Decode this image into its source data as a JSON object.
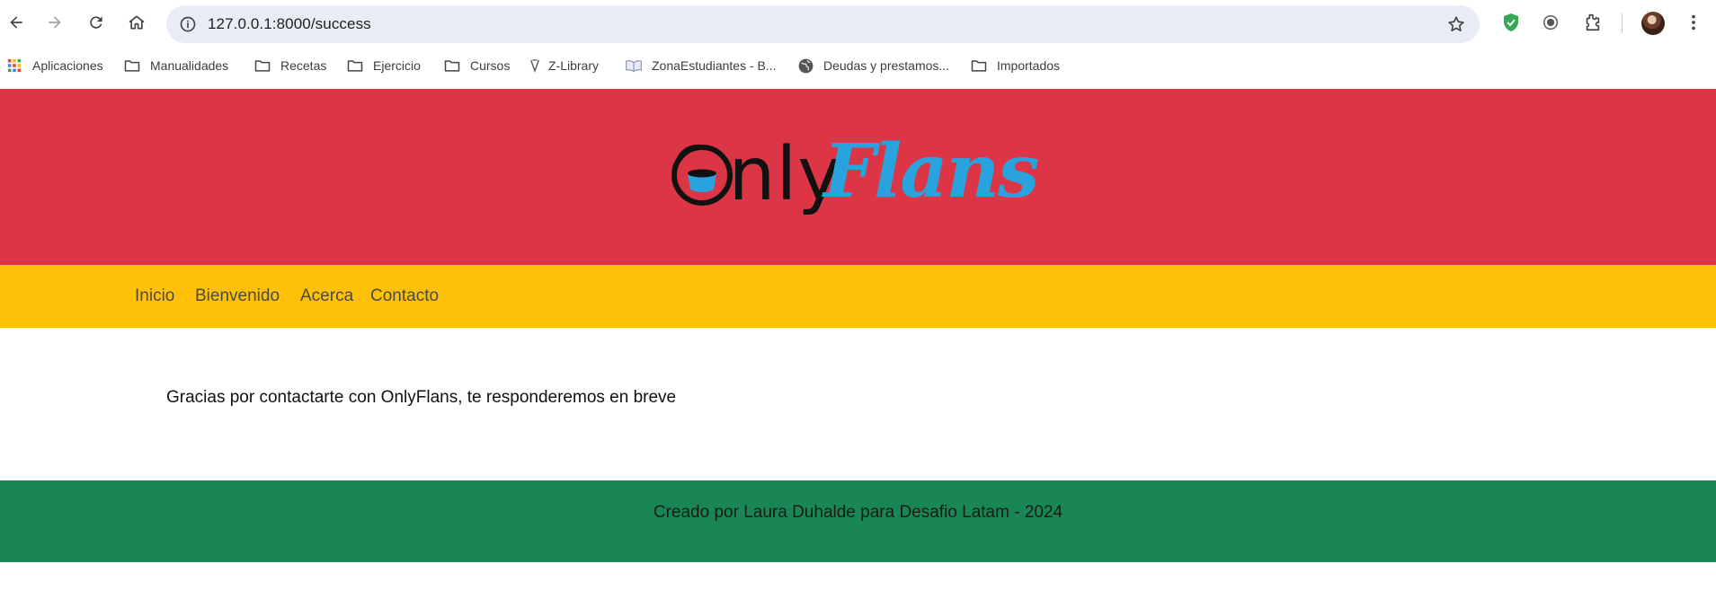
{
  "browser": {
    "url": "127.0.0.1:8000/success",
    "bookmarks": [
      {
        "label": "Aplicaciones",
        "icon": "apps-grid-icon"
      },
      {
        "label": "Manualidades",
        "icon": "folder-icon"
      },
      {
        "label": "Recetas",
        "icon": "folder-icon"
      },
      {
        "label": "Ejercicio",
        "icon": "folder-icon"
      },
      {
        "label": "Cursos",
        "icon": "folder-icon"
      },
      {
        "label": "Z-Library",
        "icon": "zlibrary-icon"
      },
      {
        "label": "ZonaEstudiantes - B...",
        "icon": "book-icon"
      },
      {
        "label": "Deudas y prestamos...",
        "icon": "globe-icon"
      },
      {
        "label": "Importados",
        "icon": "folder-icon"
      }
    ]
  },
  "logo": {
    "part1": "Only",
    "part2": "Flans",
    "accent_color": "#29a3dd"
  },
  "nav": {
    "items": [
      "Inicio",
      "Bienvenido",
      "Acerca",
      "Contacto"
    ]
  },
  "content": {
    "message": "Gracias por contactarte con OnlyFlans, te responderemos en breve"
  },
  "footer": {
    "text": "Creado por Laura Duhalde para Desafio Latam - 2024"
  },
  "colors": {
    "header": "#dc3545",
    "nav": "#ffc107",
    "footer": "#198754"
  }
}
